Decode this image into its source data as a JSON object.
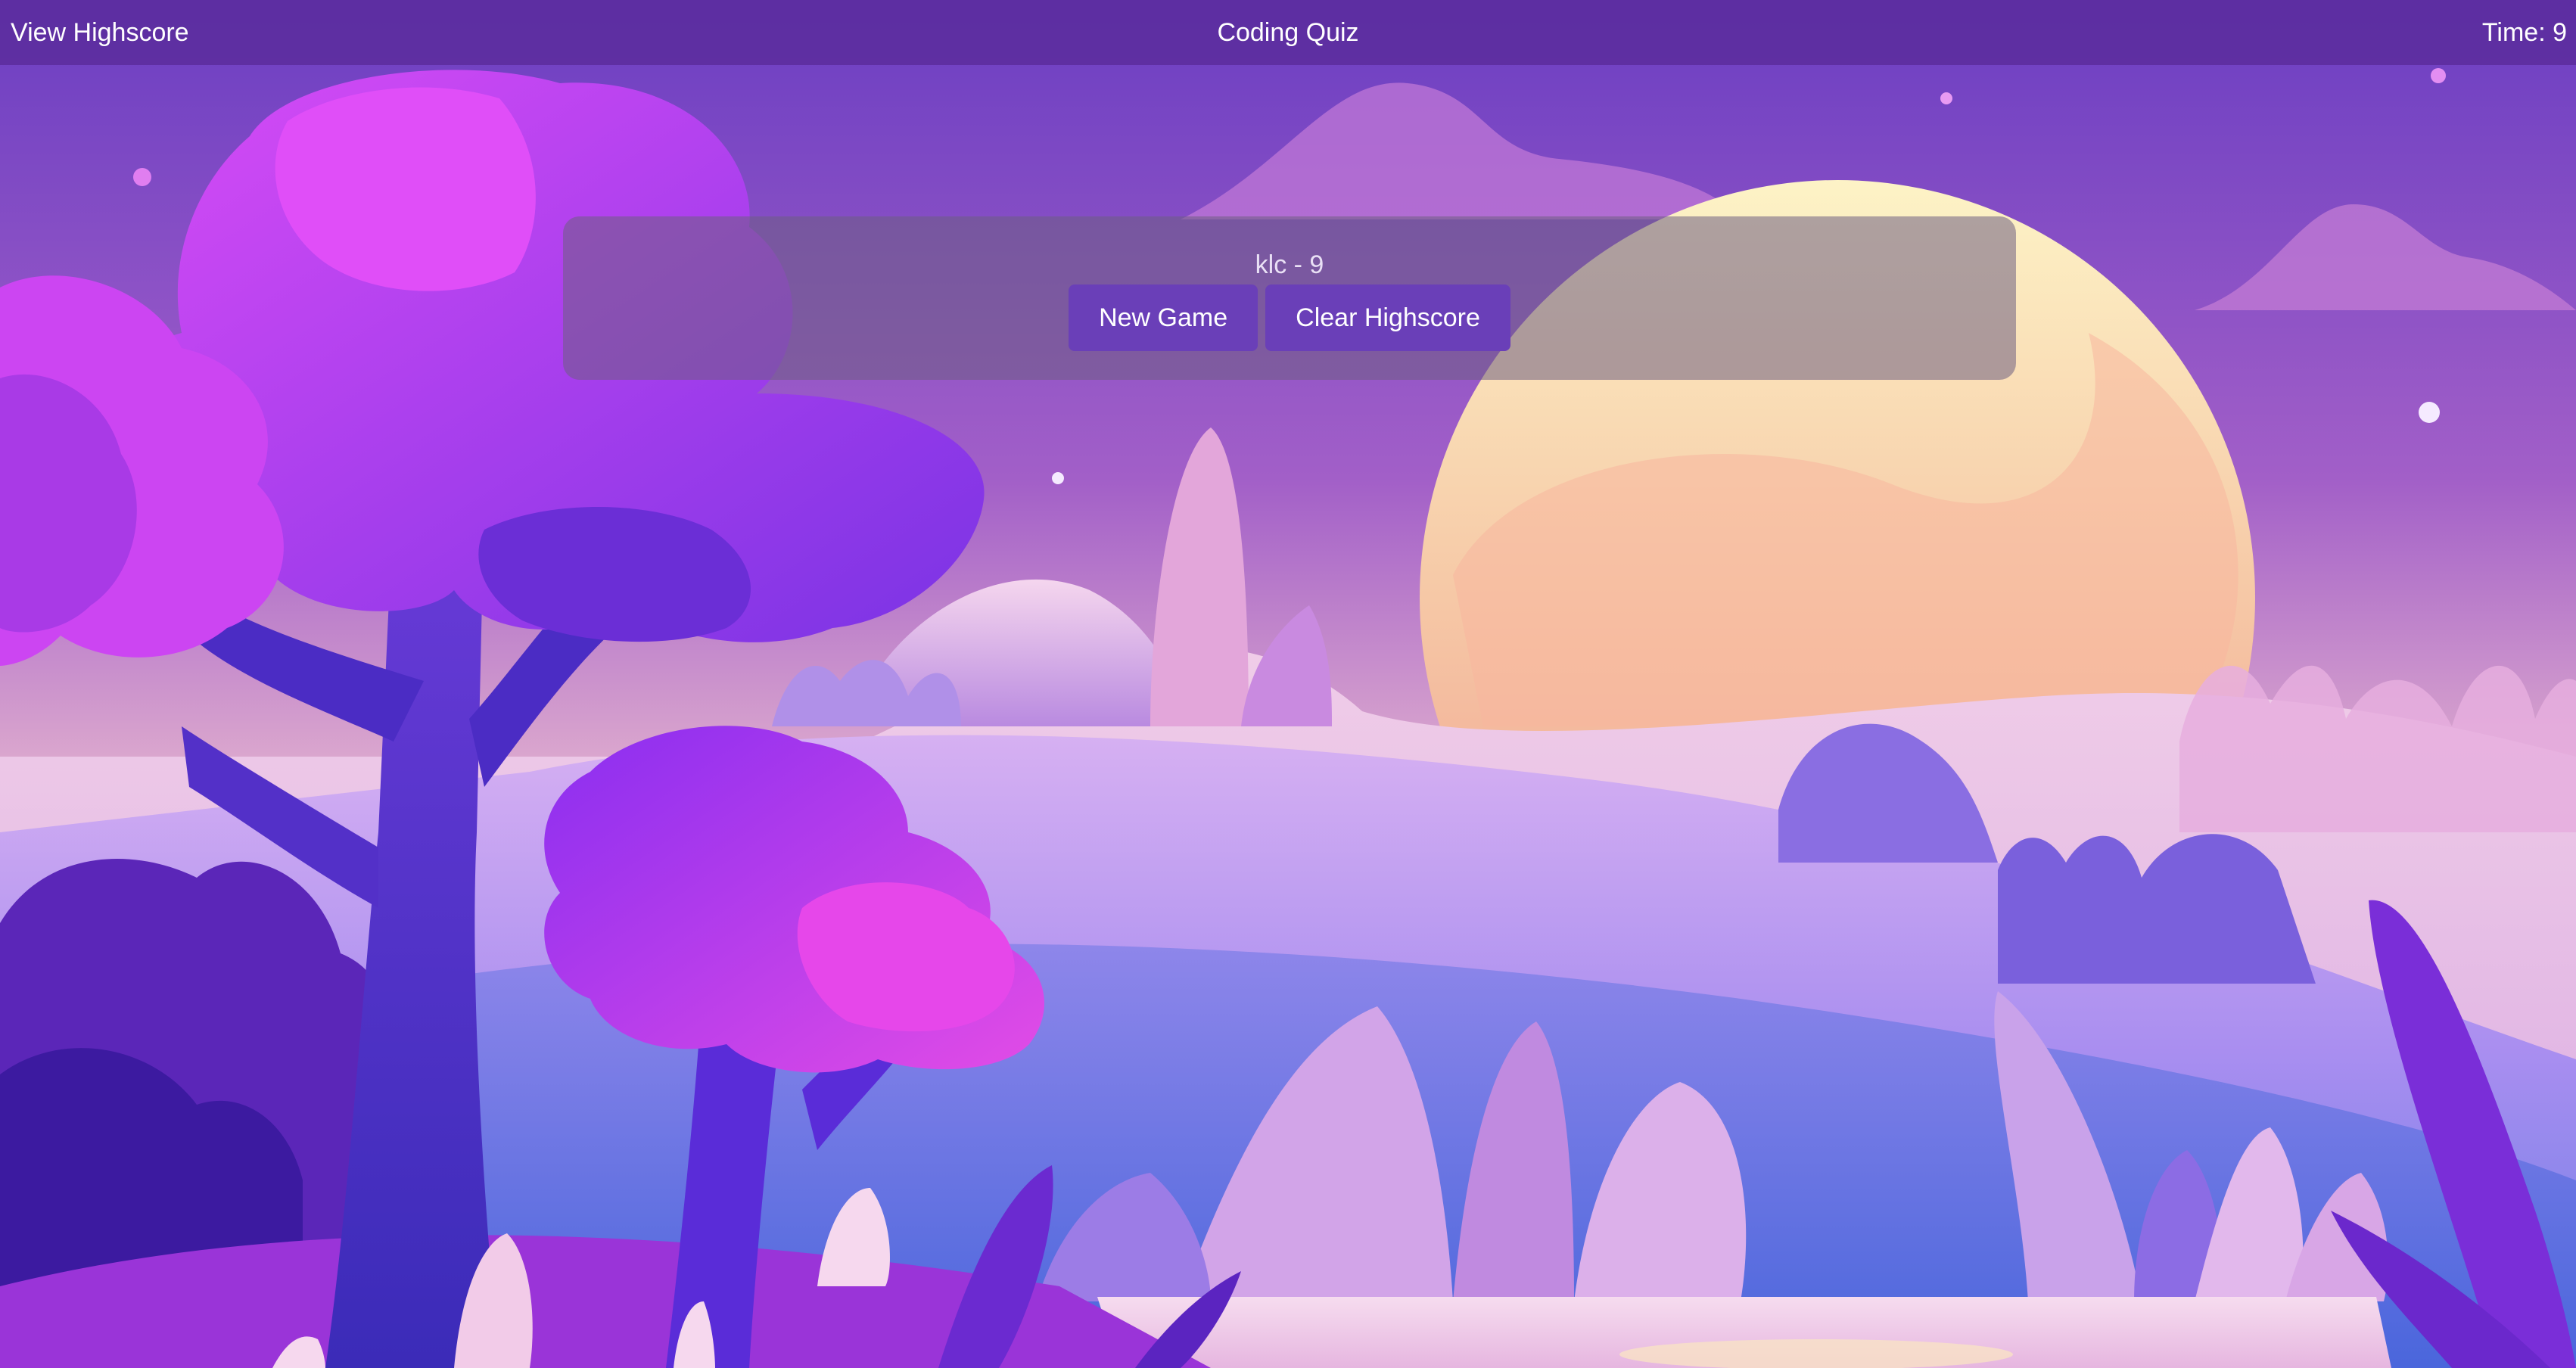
{
  "header": {
    "nav_label": "View Highscore",
    "title": "Coding Quiz",
    "timer_label": "Time: 9"
  },
  "panel": {
    "score_entry": "klc - 9",
    "new_game_label": "New Game",
    "clear_label": "Clear Highscore"
  },
  "background": {
    "description_colors": {
      "sky_top": "#6e3fc4",
      "sky_mid": "#c98ac9",
      "horizon": "#f2c9c0",
      "sun_light": "#fdf0c0",
      "sun_dark": "#f0a090",
      "hill_light": "#c9a8f0",
      "hill_deep": "#5a6ee0",
      "tree_pink": "#d94af5",
      "tree_violet": "#7b2ee8",
      "trunk": "#4a2cc0"
    }
  }
}
